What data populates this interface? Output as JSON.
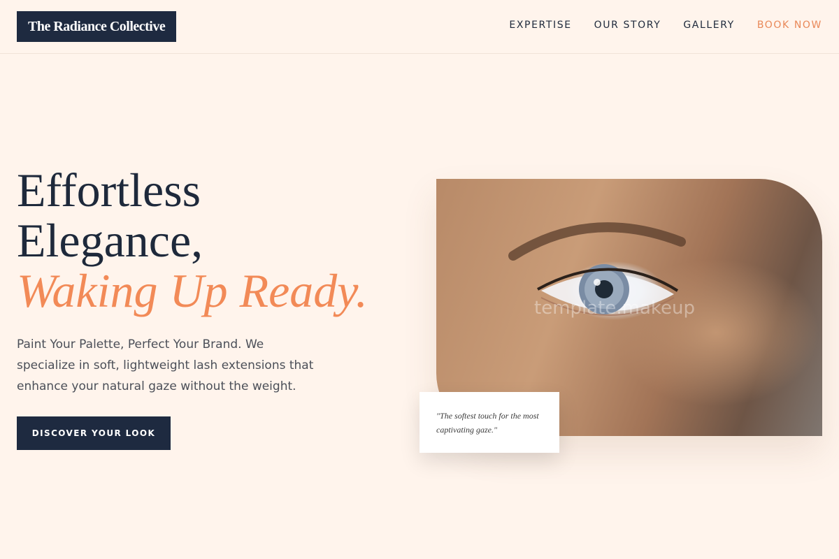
{
  "header": {
    "logo": "The Radiance Collective",
    "nav": [
      {
        "label": "EXPERTISE"
      },
      {
        "label": "OUR STORY"
      },
      {
        "label": "GALLERY"
      },
      {
        "label": "BOOK NOW"
      }
    ]
  },
  "hero": {
    "title_line1": "Effortless",
    "title_line2": "Elegance,",
    "title_accent": "Waking Up Ready.",
    "description": "Paint Your Palette, Perfect Your Brand. We specialize in soft, lightweight lash extensions that enhance your natural gaze without the weight.",
    "cta_label": "DISCOVER YOUR LOOK",
    "image_watermark": "template.makeup",
    "quote": "\"The softest touch for the most captivating gaze.\""
  },
  "colors": {
    "background": "#fff4ec",
    "navy": "#1e2a40",
    "accent": "#f28a57"
  }
}
